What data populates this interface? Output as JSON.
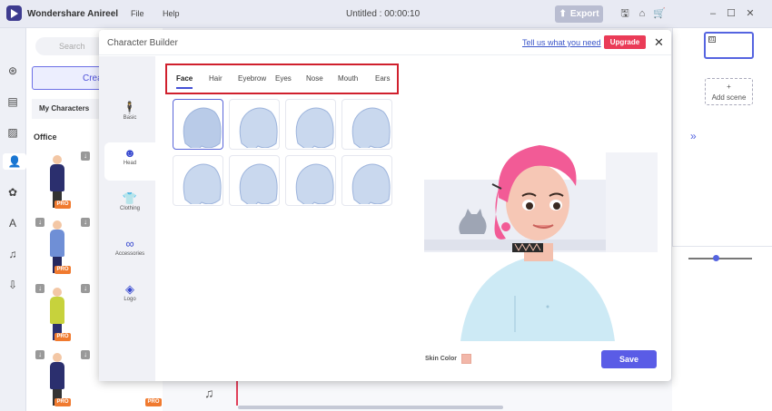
{
  "app": {
    "name": "Wondershare Anireel",
    "menu": [
      "File",
      "Help"
    ],
    "document_title": "Untitled : 00:00:10",
    "export_label": "Export"
  },
  "left_panel": {
    "search_placeholder": "Search",
    "create_label": "Create",
    "my_characters_label": "My Characters",
    "category": "Office",
    "pro_badge": "PRO"
  },
  "scenes": {
    "scene_number": "01",
    "add_scene_label": "Add scene"
  },
  "modal": {
    "title": "Character Builder",
    "feedback_link": "Tell us what you need",
    "upgrade_label": "Upgrade",
    "side_nav": [
      {
        "label": "Basic",
        "icon": "person-icon"
      },
      {
        "label": "Head",
        "icon": "head-icon"
      },
      {
        "label": "Clothing",
        "icon": "shirt-icon"
      },
      {
        "label": "Accessories",
        "icon": "glasses-icon"
      },
      {
        "label": "Logo",
        "icon": "shapes-icon"
      }
    ],
    "active_nav": "Head",
    "tabs": [
      "Face",
      "Hair",
      "Eyebrow",
      "Eyes",
      "Nose",
      "Mouth",
      "Ears"
    ],
    "active_tab": "Face",
    "skin_color_label": "Skin Color",
    "skin_color": "#f2b7a9",
    "save_label": "Save"
  },
  "colors": {
    "accent": "#5a5ce6",
    "upgrade": "#ea3b57",
    "highlight_box": "#d0202d",
    "pro": "#f07a2f"
  }
}
